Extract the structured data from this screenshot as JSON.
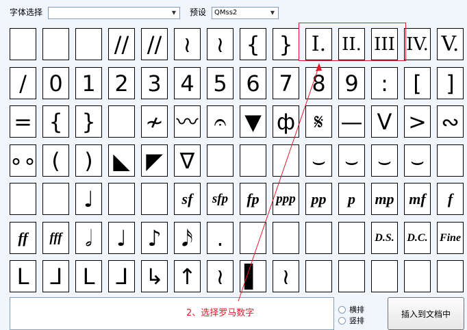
{
  "toolbar": {
    "font_label": "字体选择",
    "font_value": "",
    "preset_label": "预设",
    "preset_value": "QMss2"
  },
  "grid": {
    "rows": [
      [
        "",
        "",
        "",
        "//",
        "//",
        "≀",
        "≀",
        "{",
        "}",
        "I.",
        "II.",
        "III",
        "IV.",
        "V."
      ],
      [
        "/",
        "0",
        "1",
        "2",
        "3",
        "4",
        "5",
        "6",
        "7",
        "8",
        "9",
        ":",
        "[",
        "]"
      ],
      [
        "=",
        "{",
        "}",
        "",
        "≁",
        "〰",
        "𝄐",
        "▼",
        "ф",
        "𝄋",
        "—",
        "V",
        ">",
        "∾"
      ],
      [
        "∘∘",
        "(",
        ")",
        "◣",
        "◤",
        "∇",
        "",
        "",
        "",
        "⌣",
        "⌣",
        "⌣",
        "⌣",
        ""
      ],
      [
        "",
        "",
        "♩",
        "",
        "",
        "sf",
        "sfp",
        "fp",
        "ppp",
        "pp",
        "p",
        "mp",
        "mf",
        "f"
      ],
      [
        "ff",
        "fff",
        "𝅗𝅥",
        "♩",
        "♪",
        "𝅘𝅥𝅯",
        ".",
        "",
        "",
        "",
        "",
        "D.S.",
        "D.C.",
        "Fine"
      ],
      [
        "ᒪ",
        "ᒧ",
        "ᒪ",
        "ᒧ",
        "↳",
        "↑",
        "≀",
        "▌",
        "≀",
        "",
        "",
        "",
        "",
        ""
      ]
    ]
  },
  "annotation": {
    "text": "2、选择罗马数字"
  },
  "layout_mode": {
    "horizontal_label": "横排",
    "vertical_label": "竖排"
  },
  "actions": {
    "insert_label": "插入到文档中"
  },
  "colors": {
    "annotation": "#e8182b",
    "background": "#f1f6fd"
  }
}
